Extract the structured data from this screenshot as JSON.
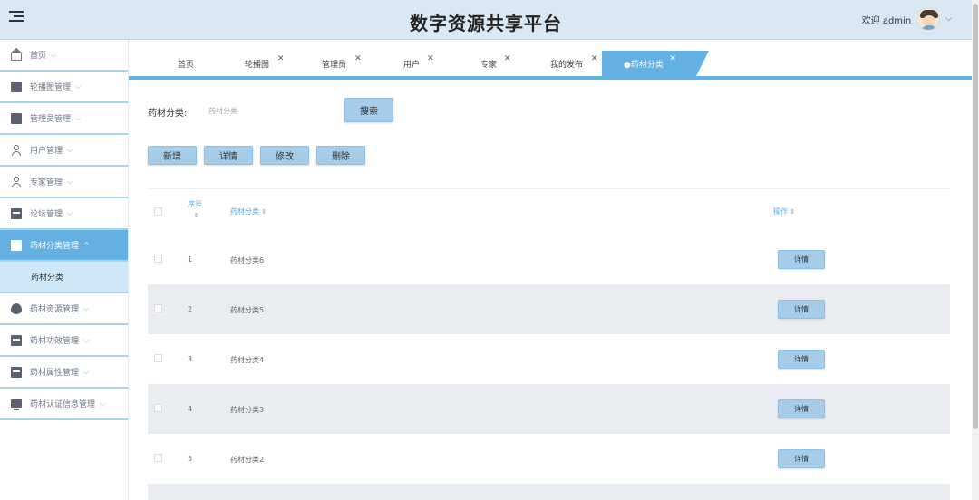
{
  "header": {
    "title": "数字资源共享平台",
    "welcome": "欢迎 admin"
  },
  "sidebar": {
    "items": [
      {
        "label": "首页",
        "icon": "home-icon"
      },
      {
        "label": "轮播图管理",
        "icon": "image-icon"
      },
      {
        "label": "管理员管理",
        "icon": "briefcase-icon"
      },
      {
        "label": "用户管理",
        "icon": "user-icon"
      },
      {
        "label": "专家管理",
        "icon": "user-icon"
      },
      {
        "label": "论坛管理",
        "icon": "card-icon"
      },
      {
        "label": "药材分类管理",
        "icon": "book-icon",
        "active": true
      },
      {
        "label": "药材资源管理",
        "icon": "drop-icon"
      },
      {
        "label": "药材功效管理",
        "icon": "tray-icon"
      },
      {
        "label": "药材属性管理",
        "icon": "tray-icon"
      },
      {
        "label": "药材认证信息管理",
        "icon": "monitor-icon"
      }
    ],
    "sub_item": "药材分类"
  },
  "tabs": [
    {
      "label": "首页",
      "closable": false
    },
    {
      "label": "轮播图",
      "closable": true
    },
    {
      "label": "管理员",
      "closable": true
    },
    {
      "label": "用户",
      "closable": true
    },
    {
      "label": "专家",
      "closable": true
    },
    {
      "label": "我的发布",
      "closable": true
    },
    {
      "label": "●药材分类",
      "closable": true,
      "active": true
    }
  ],
  "search": {
    "label": "药材分类:",
    "placeholder": "药材分类",
    "button": "搜索"
  },
  "actions": {
    "add": "新增",
    "detail": "详情",
    "edit": "修改",
    "delete": "删除"
  },
  "table": {
    "headers": {
      "index": "序号",
      "category": "药材分类",
      "operation": "操作"
    },
    "rows": [
      {
        "index": "1",
        "category": "药材分类6",
        "action": "详情"
      },
      {
        "index": "2",
        "category": "药材分类5",
        "action": "详情"
      },
      {
        "index": "3",
        "category": "药材分类4",
        "action": "详情"
      },
      {
        "index": "4",
        "category": "药材分类3",
        "action": "详情"
      },
      {
        "index": "5",
        "category": "药材分类2",
        "action": "详情"
      }
    ]
  },
  "colors": {
    "accent": "#63b0e2",
    "header_bg": "#d8e8f4",
    "button_bg": "#a5cdea",
    "stripe": "#e9edf1"
  }
}
